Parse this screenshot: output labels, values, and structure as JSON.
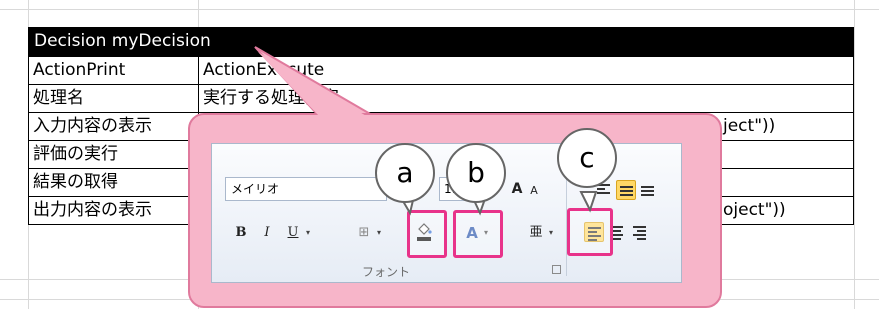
{
  "table": {
    "header": "Decision myDecision",
    "rows": [
      {
        "label": "ActionPrint",
        "value": "ActionExecute"
      },
      {
        "label": "処理名",
        "value": "実行する処理内容"
      },
      {
        "label": "入力内容の表示",
        "value": "ject\"))"
      },
      {
        "label": "評価の実行",
        "value": ""
      },
      {
        "label": "結果の取得",
        "value": ""
      },
      {
        "label": "出力内容の表示",
        "value": "oject\"))"
      }
    ]
  },
  "ribbon": {
    "font_name": "メイリオ",
    "font_size": "11",
    "group_label": "フォント",
    "bold_label": "B",
    "italic_label": "I",
    "underline_label": "U",
    "font_color_letter": "A",
    "phonetic_label": "亜"
  },
  "badges": {
    "a": "a",
    "b": "b",
    "c": "c"
  },
  "colors": {
    "callout_fill": "#f7b5c9",
    "highlight": "#e8338a",
    "header_fill": "#000000",
    "active_align": "#ffd866"
  }
}
